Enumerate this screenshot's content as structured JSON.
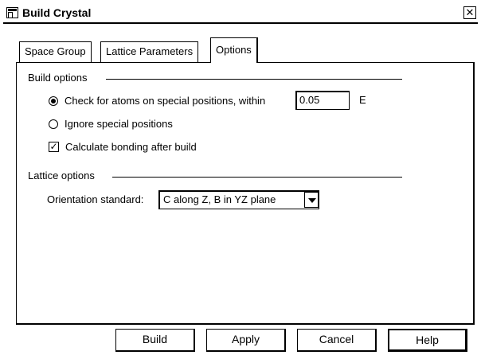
{
  "window": {
    "title": "Build Crystal",
    "close_glyph": "✕",
    "app_icon": "window-icon"
  },
  "tabs": [
    {
      "label": "Space Group",
      "active": false
    },
    {
      "label": "Lattice Parameters",
      "active": false
    },
    {
      "label": "Options",
      "active": true
    }
  ],
  "build_options": {
    "title": "Build options",
    "check_special": {
      "label": "Check for atoms on special positions, within",
      "checked": true
    },
    "tolerance": {
      "value": "0.05",
      "unit": "E"
    },
    "ignore_special": {
      "label": "Ignore special positions",
      "checked": false
    },
    "calc_bonding": {
      "label": "Calculate bonding after build",
      "checked": true,
      "glyph": "✓"
    }
  },
  "lattice_options": {
    "title": "Lattice options",
    "orientation_label": "Orientation standard:",
    "orientation_value": "C along Z, B in YZ plane"
  },
  "buttons": {
    "build": "Build",
    "apply": "Apply",
    "cancel": "Cancel",
    "help": "Help"
  }
}
